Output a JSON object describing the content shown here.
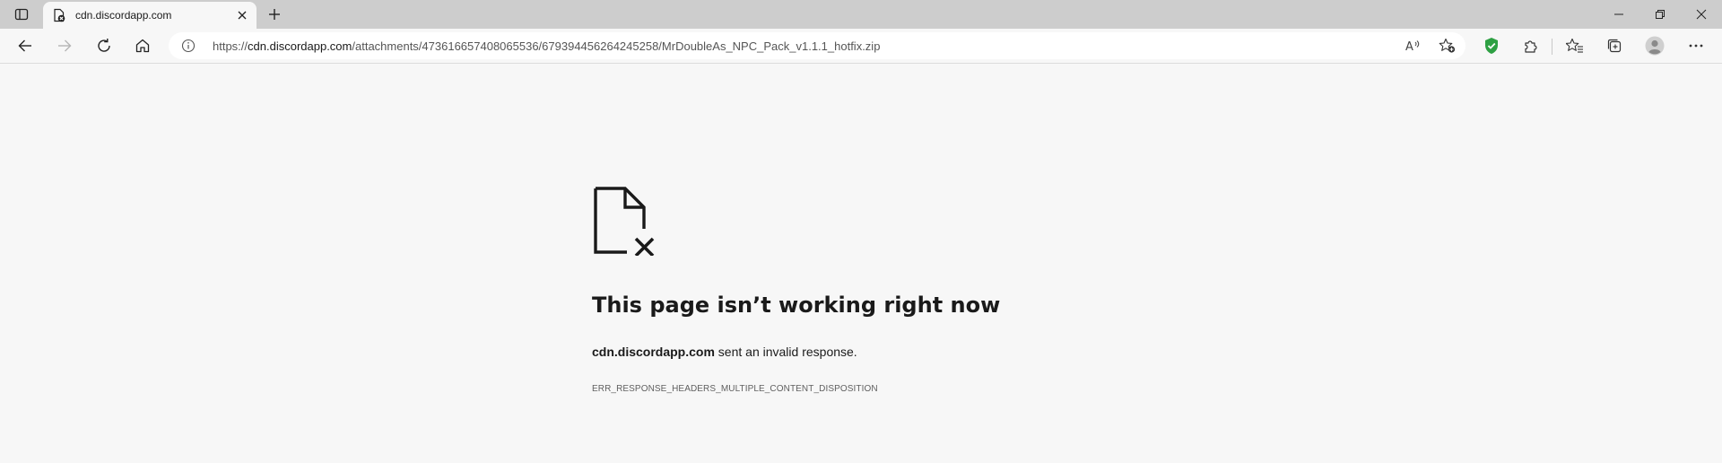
{
  "tab": {
    "title": "cdn.discordapp.com"
  },
  "address_bar": {
    "url_prefix": "https://",
    "url_host": "cdn.discordapp.com",
    "url_path": "/attachments/473616657408065536/679394456264245258/MrDoubleAs_NPC_Pack_v1.1.1_hotfix.zip"
  },
  "error": {
    "title": "This page isn’t working right now",
    "host": "cdn.discordapp.com",
    "message": " sent an invalid response.",
    "code": "ERR_RESPONSE_HEADERS_MULTIPLE_CONTENT_DISPOSITION"
  },
  "icons": {
    "tab_actions": "tab-actions-icon",
    "favicon": "discord-favicon-icon",
    "close": "close-icon",
    "new_tab": "plus-icon",
    "minimize": "minimize-icon",
    "restore": "restore-icon",
    "window_close": "close-icon",
    "back": "back-arrow-icon",
    "forward": "forward-arrow-icon",
    "refresh": "refresh-icon",
    "home": "home-icon",
    "site_info": "info-icon",
    "read_aloud": "read-aloud-icon",
    "add_favorite": "star-plus-icon",
    "shield": "shield-icon",
    "extensions": "puzzle-icon",
    "favorites": "favorites-icon",
    "collections": "collections-icon",
    "profile": "profile-icon",
    "more": "more-icon",
    "error_page": "broken-file-icon"
  },
  "colors": {
    "tabbar_bg": "#cdcdcd",
    "page_bg": "#f7f7f7",
    "shield_green": "#2ea043"
  }
}
